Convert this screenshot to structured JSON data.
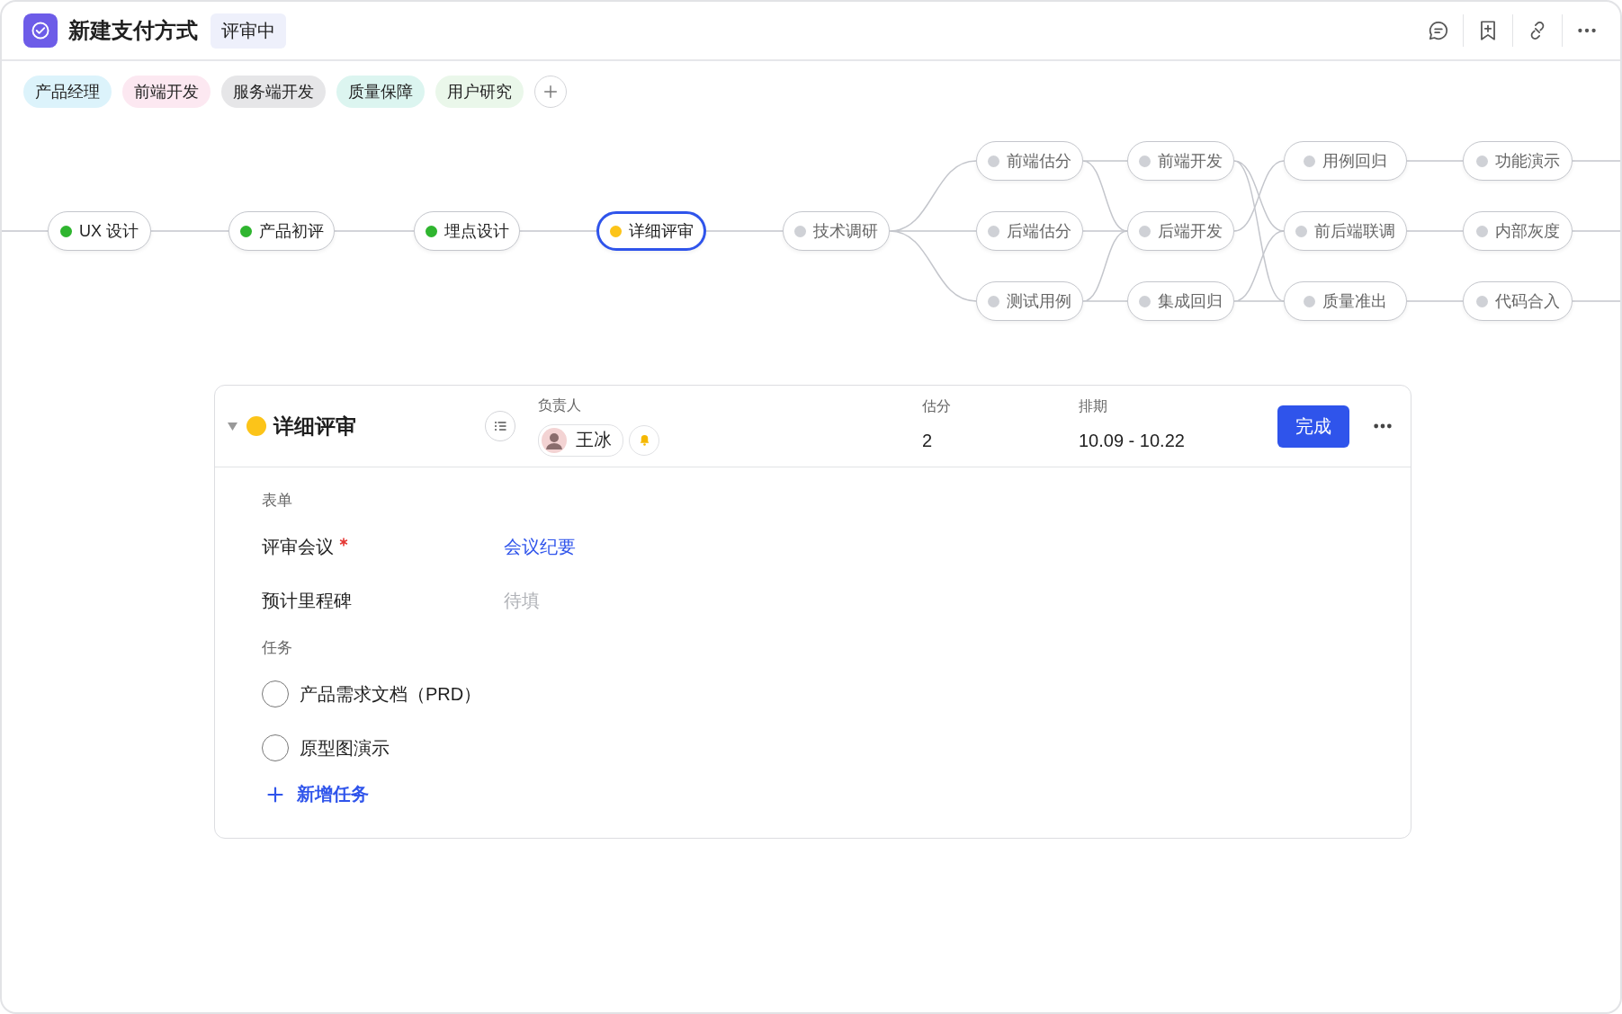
{
  "header": {
    "title": "新建支付方式",
    "status_badge": "评审中"
  },
  "role_tags": [
    {
      "label": "产品经理",
      "color": "#dcf3fb"
    },
    {
      "label": "前端开发",
      "color": "#fce8f1"
    },
    {
      "label": "服务端开发",
      "color": "#e6e6e8"
    },
    {
      "label": "质量保障",
      "color": "#dcf5f0"
    },
    {
      "label": "用户研究",
      "color": "#eaf7ea"
    }
  ],
  "workflow": {
    "nodes": [
      {
        "label": "UX 设计",
        "color": "#2fb52f",
        "selected": false
      },
      {
        "label": "产品初评",
        "color": "#2fb52f",
        "selected": false
      },
      {
        "label": "埋点设计",
        "color": "#2fb52f",
        "selected": false
      },
      {
        "label": "详细评审",
        "color": "#fcc419",
        "selected": true
      },
      {
        "label": "技术调研",
        "color": "#cfd1d6",
        "selected": false
      },
      {
        "label": "前端估分",
        "color": "#cfd1d6",
        "selected": false
      },
      {
        "label": "后端估分",
        "color": "#cfd1d6",
        "selected": false
      },
      {
        "label": "测试用例",
        "color": "#cfd1d6",
        "selected": false
      },
      {
        "label": "前端开发",
        "color": "#cfd1d6",
        "selected": false
      },
      {
        "label": "后端开发",
        "color": "#cfd1d6",
        "selected": false
      },
      {
        "label": "集成回归",
        "color": "#cfd1d6",
        "selected": false
      },
      {
        "label": "用例回归",
        "color": "#cfd1d6",
        "selected": false
      },
      {
        "label": "前后端联调",
        "color": "#cfd1d6",
        "selected": false
      },
      {
        "label": "质量准出",
        "color": "#cfd1d6",
        "selected": false
      },
      {
        "label": "功能演示",
        "color": "#cfd1d6",
        "selected": false
      },
      {
        "label": "内部灰度",
        "color": "#cfd1d6",
        "selected": false
      },
      {
        "label": "代码合入",
        "color": "#cfd1d6",
        "selected": false
      }
    ]
  },
  "detail_card": {
    "expanded": true,
    "title": "详细评审",
    "color": "#fcc419",
    "assignee_label": "负责人",
    "assignee": "王冰",
    "estimate_label": "估分",
    "estimate": "2",
    "schedule_label": "排期",
    "schedule": "10.09 - 10.22",
    "complete_button": "完成",
    "form_heading": "表单",
    "fields": [
      {
        "label": "评审会议",
        "required": true,
        "kind": "link",
        "value": "会议纪要"
      },
      {
        "label": "预计里程碑",
        "required": false,
        "kind": "input",
        "placeholder": "待填"
      }
    ],
    "tasks_heading": "任务",
    "tasks": [
      {
        "label": "产品需求文档（PRD）",
        "checked": false
      },
      {
        "label": "原型图演示",
        "checked": false
      }
    ],
    "add_task": "新增任务"
  }
}
